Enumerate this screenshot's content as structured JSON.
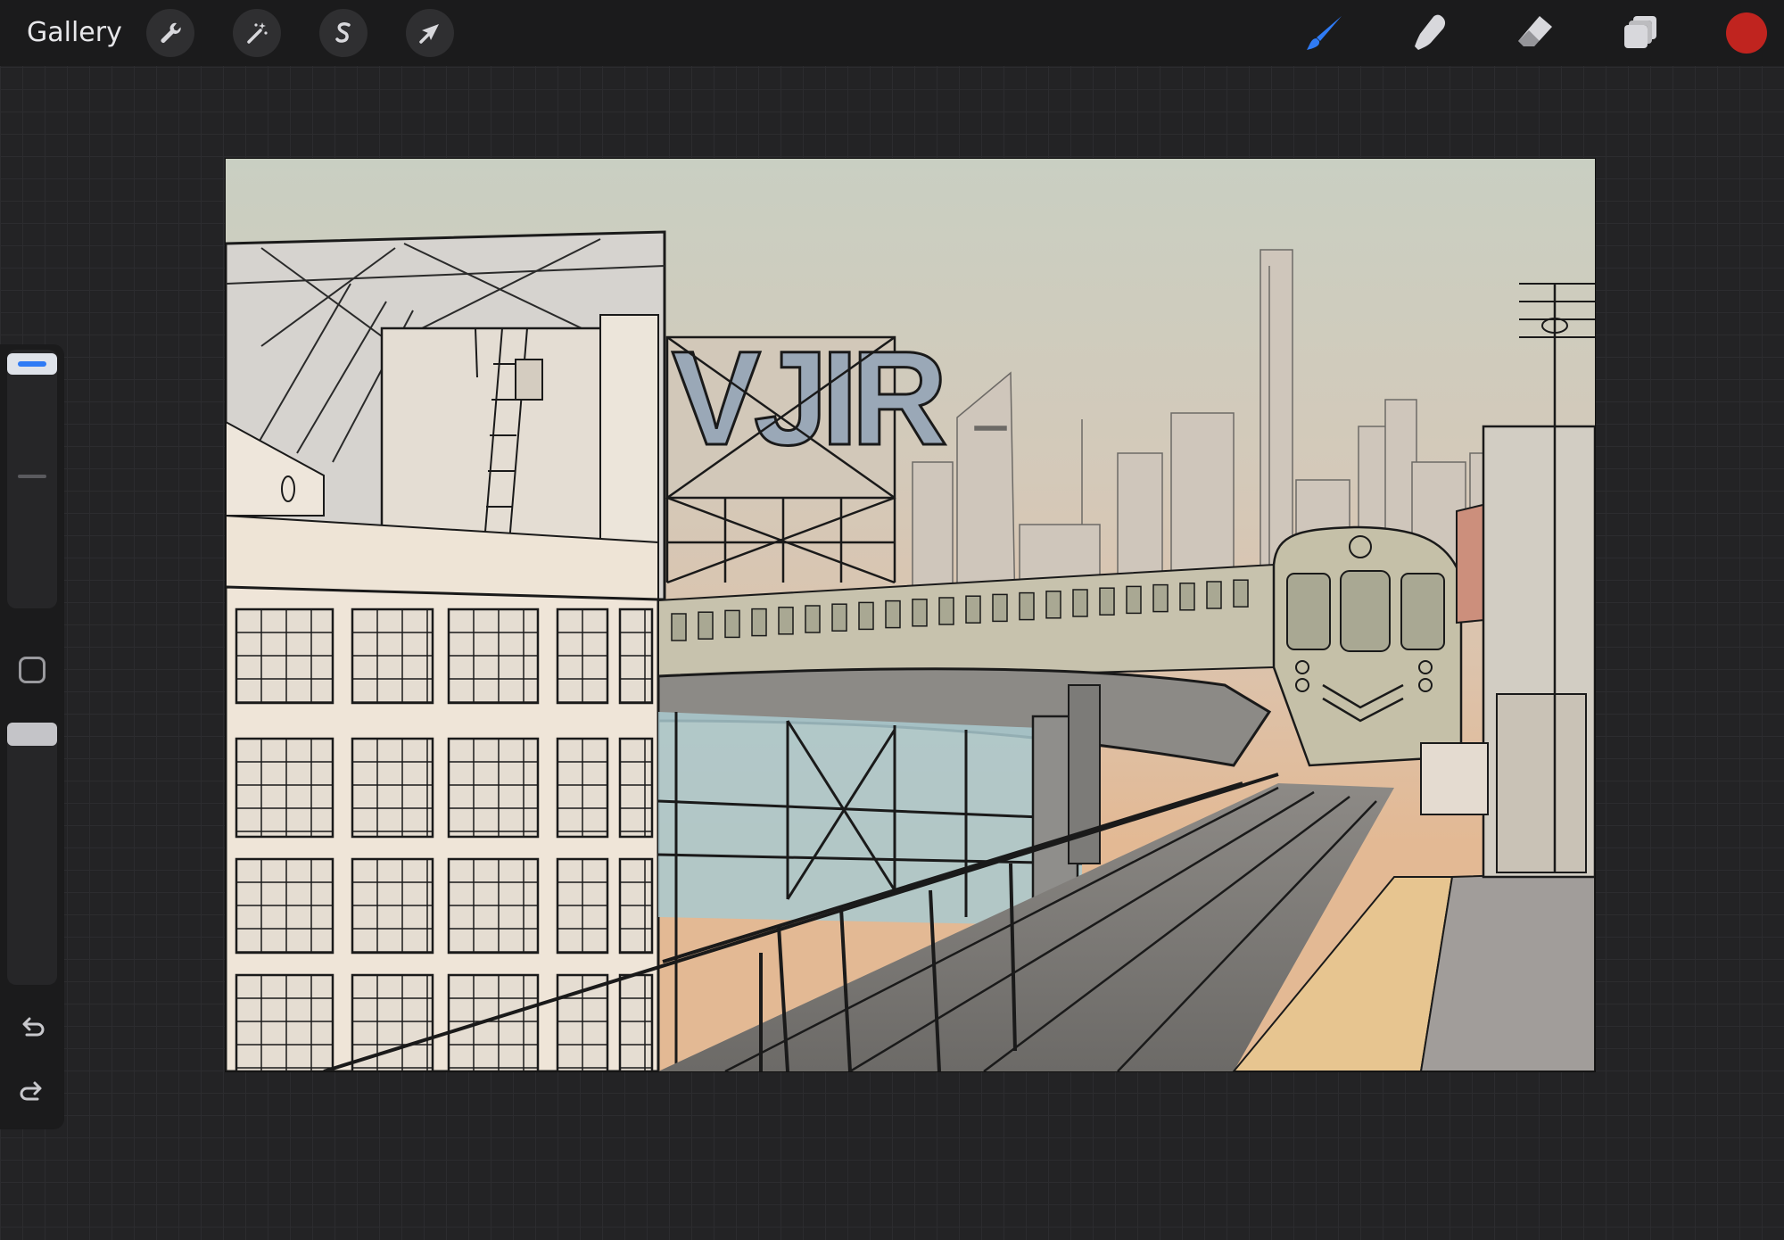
{
  "app": {
    "gallery_label": "Gallery"
  },
  "toolbar": {
    "left_tools": [
      {
        "name": "actions",
        "icon": "wrench-icon"
      },
      {
        "name": "adjustments",
        "icon": "magic-wand-icon"
      },
      {
        "name": "selection",
        "icon": "selection-s-icon"
      },
      {
        "name": "transform",
        "icon": "arrow-cursor-icon"
      }
    ],
    "right_tools": [
      {
        "name": "brush",
        "icon": "brush-icon",
        "active": true
      },
      {
        "name": "smudge",
        "icon": "smudge-finger-icon",
        "active": false
      },
      {
        "name": "eraser",
        "icon": "eraser-icon",
        "active": false
      },
      {
        "name": "layers",
        "icon": "layers-icon",
        "active": false
      }
    ],
    "current_color": "#c0241f",
    "accent_color": "#2f7bf5"
  },
  "sidebar": {
    "brush_size_level": 0.0,
    "opacity_level": 0.0,
    "modify_icon": "square-icon",
    "undo_icon": "undo-icon",
    "redo_icon": "redo-icon"
  }
}
